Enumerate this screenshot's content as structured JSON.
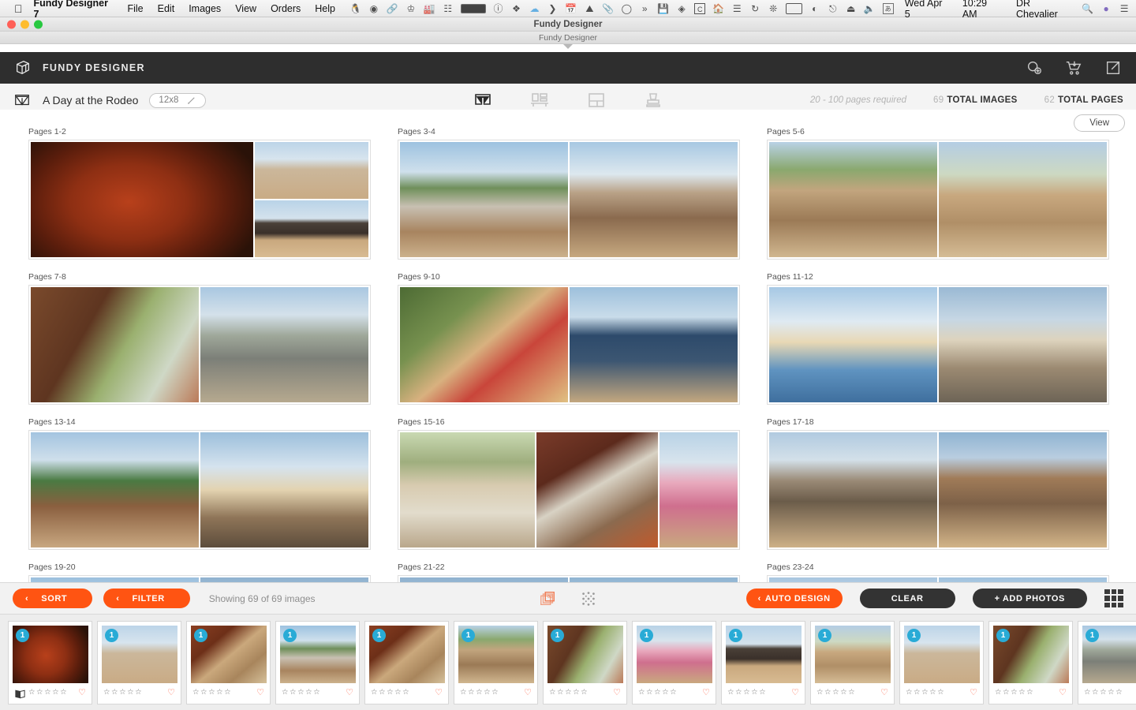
{
  "menubar": {
    "apple": "",
    "app_name": "Fundy Designer 7",
    "menus": [
      "File",
      "Edit",
      "Images",
      "View",
      "Orders",
      "Help"
    ],
    "date": "Wed Apr 5",
    "time": "10:29 AM",
    "user": "DR Chevalier",
    "tray_icons": [
      "evernote-icon",
      "disc-icon",
      "link-icon",
      "cleanup-icon",
      "toolbox-icon",
      "equalizer-icon",
      "meter-icon",
      "info-icon",
      "dropbox-icon",
      "cloud-icon",
      "chevron-icon",
      "calendar-icon",
      "bowler-hat-icon",
      "paperclip-icon",
      "clock-icon",
      "transfer-icon",
      "drive-icon",
      "timer-icon",
      "c-icon",
      "house-icon",
      "levels-icon",
      "bars-icon",
      "time-machine-icon",
      "bluetooth-icon",
      "battery-icon",
      "wifi-icon",
      "airplay-icon",
      "eject-icon",
      "volume-icon",
      "input-source-icon",
      "spotlight-icon",
      "account-icon",
      "notification-center-icon"
    ]
  },
  "window": {
    "title": "Fundy Designer",
    "subtitle": "Fundy Designer",
    "traffic": {
      "close": "#ff5f57",
      "minimize": "#febc2e",
      "zoom": "#28c840"
    }
  },
  "app_header": {
    "brand": "FUNDY DESIGNER",
    "logo": "fundy-cube-logo",
    "icons": [
      "design-settings-icon",
      "shopping-cart-icon",
      "export-icon"
    ]
  },
  "toolbar": {
    "project_name": "A Day at the Rodeo",
    "size": "12x8",
    "edit_icon": "pencil-icon",
    "tools": [
      {
        "name": "album-tool",
        "active": true
      },
      {
        "name": "wall-art-tool",
        "active": false
      },
      {
        "name": "layout-tool",
        "active": false
      },
      {
        "name": "design-tool",
        "active": false
      }
    ],
    "pages_required": "20 - 100 pages required",
    "total_images_value": "69",
    "total_images_label": "TOTAL IMAGES",
    "total_pages_value": "62",
    "total_pages_label": "TOTAL PAGES"
  },
  "canvas": {
    "view_button": "View",
    "spreads": [
      {
        "label": "Pages 1-2",
        "layout": "big-left-two-right",
        "photos": [
          "p-saddle",
          "p-pens",
          "p-truck"
        ]
      },
      {
        "label": "Pages 3-4",
        "layout": "two-equal",
        "photos": [
          "p-rider1",
          "p-rider2"
        ]
      },
      {
        "label": "Pages 5-6",
        "layout": "two-equal",
        "photos": [
          "p-rope1",
          "p-rope2"
        ]
      },
      {
        "label": "Pages 7-8",
        "layout": "two-equal",
        "photos": [
          "p-horse1",
          "p-fence"
        ]
      },
      {
        "label": "Pages 9-10",
        "layout": "two-equal",
        "photos": [
          "p-clown",
          "p-blue"
        ]
      },
      {
        "label": "Pages 11-12",
        "layout": "two-equal",
        "photos": [
          "p-boy",
          "p-man"
        ]
      },
      {
        "label": "Pages 13-14",
        "layout": "two-equal",
        "photos": [
          "p-kids",
          "p-portrait"
        ]
      },
      {
        "label": "Pages 15-16",
        "layout": "three-across",
        "photos": [
          "p-toddler",
          "p-dog",
          "p-girl"
        ]
      },
      {
        "label": "Pages 17-18",
        "layout": "two-equal",
        "photos": [
          "p-barrel",
          "p-crowd"
        ]
      },
      {
        "label": "Pages 19-20",
        "layout": "two-equal",
        "photos": [
          "p-sky",
          "p-stand"
        ]
      },
      {
        "label": "Pages 21-22",
        "layout": "two-equal",
        "photos": [
          "p-stand",
          "p-crowd"
        ]
      },
      {
        "label": "Pages 23-24",
        "layout": "two-equal",
        "photos": [
          "p-pal",
          "p-hat"
        ]
      }
    ]
  },
  "bottom_bar": {
    "sort_label": "SORT",
    "filter_label": "FILTER",
    "chevron": "‹",
    "showing": "Showing 69 of 69 images",
    "center_icons": [
      "stacked-photos-icon",
      "scattered-dots-icon"
    ],
    "auto_design_label": "AUTO DESIGN",
    "clear_label": "CLEAR",
    "add_photos_label": "+ ADD PHOTOS",
    "grid_view_icon": "grid-view-icon",
    "accent_orange": "#ff5412",
    "dark_button": "#333333"
  },
  "filmstrip": {
    "star": "☆",
    "heart": "♡",
    "badge_color": "#29abd6",
    "thumbs": [
      {
        "badge": "1",
        "photo": "p-saddle",
        "book": true
      },
      {
        "badge": "1",
        "photo": "p-pens",
        "book": false
      },
      {
        "badge": "1",
        "photo": "p-cow",
        "book": false
      },
      {
        "badge": "1",
        "photo": "p-rider1",
        "book": false
      },
      {
        "badge": "1",
        "photo": "p-cow",
        "book": false
      },
      {
        "badge": "1",
        "photo": "p-rope1",
        "book": false
      },
      {
        "badge": "1",
        "photo": "p-horse1",
        "book": false
      },
      {
        "badge": "1",
        "photo": "p-girl",
        "book": false
      },
      {
        "badge": "1",
        "photo": "p-truck",
        "book": false
      },
      {
        "badge": "1",
        "photo": "p-rope2",
        "book": false
      },
      {
        "badge": "1",
        "photo": "p-pens",
        "book": false
      },
      {
        "badge": "1",
        "photo": "p-horse1",
        "book": false
      },
      {
        "badge": "1",
        "photo": "p-fence",
        "book": false
      }
    ]
  }
}
